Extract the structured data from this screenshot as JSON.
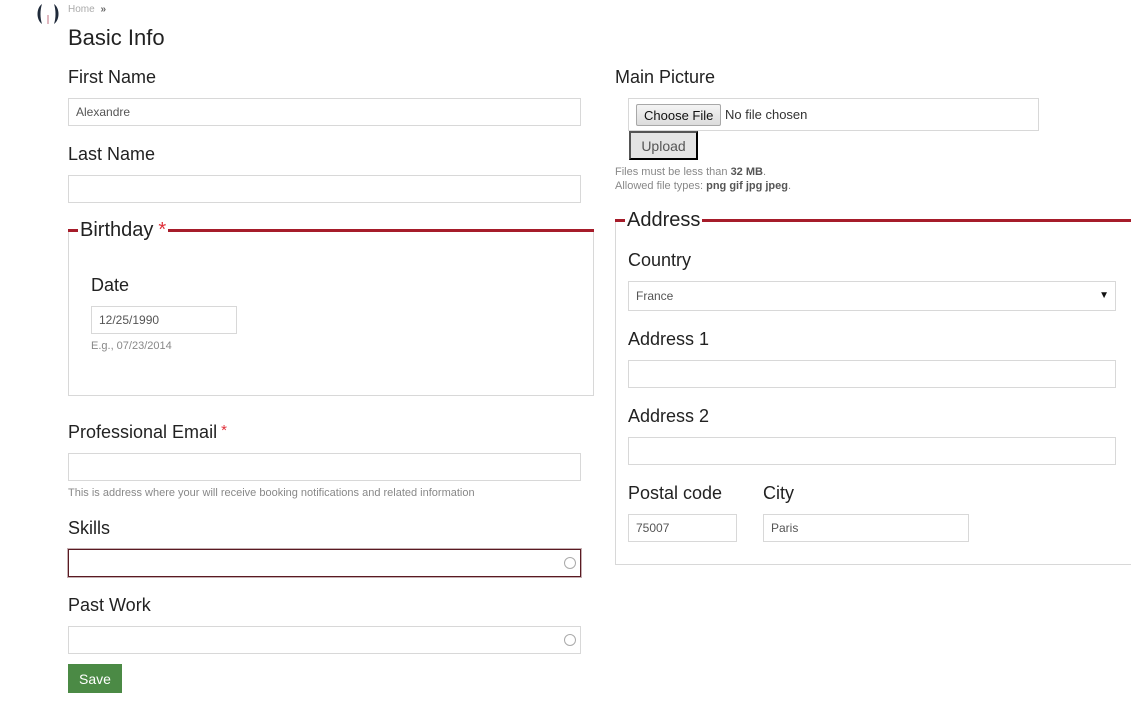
{
  "breadcrumb": {
    "home": "Home",
    "separator": "»"
  },
  "page": {
    "title": "Basic Info"
  },
  "form": {
    "first_name": {
      "label": "First Name",
      "value": "Alexandre"
    },
    "last_name": {
      "label": "Last Name",
      "value": ""
    },
    "birthday": {
      "legend": "Birthday",
      "required_mark": "*",
      "date_label": "Date",
      "date_value": "12/25/1990",
      "date_help": "E.g., 07/23/2014"
    },
    "professional_email": {
      "label": "Professional Email",
      "required_mark": "*",
      "value": "",
      "help": "This is address where your will receive booking notifications and related information"
    },
    "skills": {
      "label": "Skills",
      "value": ""
    },
    "past_work": {
      "label": "Past Work",
      "value": ""
    },
    "save_label": "Save"
  },
  "picture": {
    "label": "Main Picture",
    "choose_file_label": "Choose File",
    "no_file_text": "No file chosen",
    "upload_label": "Upload",
    "size_help_prefix": "Files must be less than ",
    "size_limit": "32 MB",
    "types_help_prefix": "Allowed file types: ",
    "types": "png gif jpg jpeg"
  },
  "address": {
    "legend": "Address",
    "country": {
      "label": "Country",
      "value": "France"
    },
    "address1": {
      "label": "Address 1",
      "value": ""
    },
    "address2": {
      "label": "Address 2",
      "value": ""
    },
    "postal_code": {
      "label": "Postal code",
      "value": "75007"
    },
    "city": {
      "label": "City",
      "value": "Paris"
    }
  },
  "colors": {
    "accent_line": "#a61c2a",
    "required": "#e0303a",
    "save_button": "#4b8a45"
  }
}
